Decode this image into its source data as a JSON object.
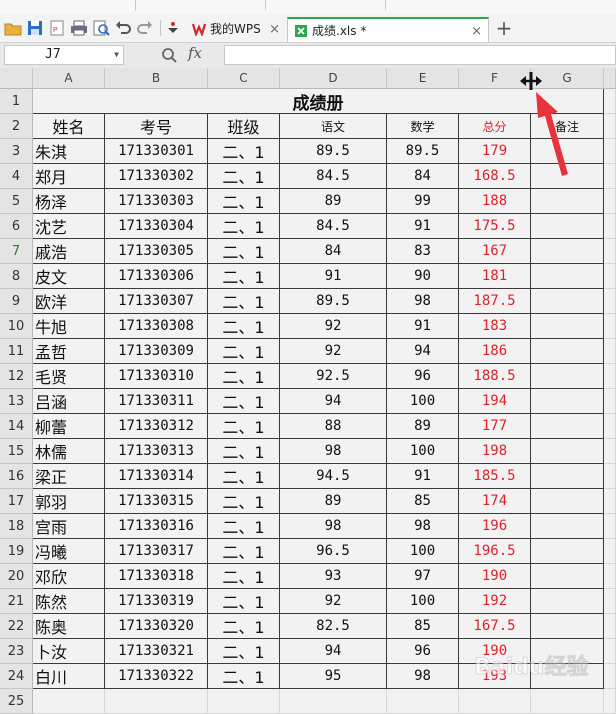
{
  "tabs": {
    "wps_label": "我的WPS",
    "file_label": "成绩.xls *",
    "close_glyph": "×",
    "add_glyph": "+"
  },
  "formula_bar": {
    "name_box": "J7",
    "fx_label": "fx",
    "formula": ""
  },
  "sheet": {
    "columns": [
      "A",
      "B",
      "C",
      "D",
      "E",
      "F",
      "G"
    ],
    "selected_row": 7,
    "title": "成绩册",
    "headers": [
      "姓名",
      "考号",
      "班级",
      "语文",
      "数学",
      "总分",
      "备注"
    ],
    "rows": [
      {
        "n": "3",
        "name": "朱淇",
        "id": "171330301",
        "cls": "二、1",
        "yw": "89.5",
        "sx": "89.5",
        "zf": "179"
      },
      {
        "n": "4",
        "name": "郑月",
        "id": "171330302",
        "cls": "二、1",
        "yw": "84.5",
        "sx": "84",
        "zf": "168.5"
      },
      {
        "n": "5",
        "name": "杨泽",
        "id": "171330303",
        "cls": "二、1",
        "yw": "89",
        "sx": "99",
        "zf": "188"
      },
      {
        "n": "6",
        "name": "沈艺",
        "id": "171330304",
        "cls": "二、1",
        "yw": "84.5",
        "sx": "91",
        "zf": "175.5"
      },
      {
        "n": "7",
        "name": "戚浩",
        "id": "171330305",
        "cls": "二、1",
        "yw": "84",
        "sx": "83",
        "zf": "167"
      },
      {
        "n": "8",
        "name": "皮文",
        "id": "171330306",
        "cls": "二、1",
        "yw": "91",
        "sx": "90",
        "zf": "181"
      },
      {
        "n": "9",
        "name": "欧洋",
        "id": "171330307",
        "cls": "二、1",
        "yw": "89.5",
        "sx": "98",
        "zf": "187.5"
      },
      {
        "n": "10",
        "name": "牛旭",
        "id": "171330308",
        "cls": "二、1",
        "yw": "92",
        "sx": "91",
        "zf": "183"
      },
      {
        "n": "11",
        "name": "孟哲",
        "id": "171330309",
        "cls": "二、1",
        "yw": "92",
        "sx": "94",
        "zf": "186"
      },
      {
        "n": "12",
        "name": "毛贤",
        "id": "171330310",
        "cls": "二、1",
        "yw": "92.5",
        "sx": "96",
        "zf": "188.5"
      },
      {
        "n": "13",
        "name": "吕涵",
        "id": "171330311",
        "cls": "二、1",
        "yw": "94",
        "sx": "100",
        "zf": "194"
      },
      {
        "n": "14",
        "name": "柳蕾",
        "id": "171330312",
        "cls": "二、1",
        "yw": "88",
        "sx": "89",
        "zf": "177"
      },
      {
        "n": "15",
        "name": "林儒",
        "id": "171330313",
        "cls": "二、1",
        "yw": "98",
        "sx": "100",
        "zf": "198"
      },
      {
        "n": "16",
        "name": "梁正",
        "id": "171330314",
        "cls": "二、1",
        "yw": "94.5",
        "sx": "91",
        "zf": "185.5"
      },
      {
        "n": "17",
        "name": "郭羽",
        "id": "171330315",
        "cls": "二、1",
        "yw": "89",
        "sx": "85",
        "zf": "174"
      },
      {
        "n": "18",
        "name": "宫雨",
        "id": "171330316",
        "cls": "二、1",
        "yw": "98",
        "sx": "98",
        "zf": "196"
      },
      {
        "n": "19",
        "name": "冯曦",
        "id": "171330317",
        "cls": "二、1",
        "yw": "96.5",
        "sx": "100",
        "zf": "196.5"
      },
      {
        "n": "20",
        "name": "邓欣",
        "id": "171330318",
        "cls": "二、1",
        "yw": "93",
        "sx": "97",
        "zf": "190"
      },
      {
        "n": "21",
        "name": "陈然",
        "id": "171330319",
        "cls": "二、1",
        "yw": "92",
        "sx": "100",
        "zf": "192"
      },
      {
        "n": "22",
        "name": "陈奥",
        "id": "171330320",
        "cls": "二、1",
        "yw": "82.5",
        "sx": "85",
        "zf": "167.5"
      },
      {
        "n": "23",
        "name": "卜汝",
        "id": "171330321",
        "cls": "二、1",
        "yw": "94",
        "sx": "96",
        "zf": "190"
      },
      {
        "n": "24",
        "name": "白川",
        "id": "171330322",
        "cls": "二、1",
        "yw": "95",
        "sx": "98",
        "zf": "193"
      }
    ],
    "title_row_number": "1",
    "header_row_number": "2",
    "extra_row_number": "25"
  },
  "colors": {
    "total_red": "#e0212b",
    "annotation_red": "#e8323c",
    "active_tab_green": "#2aa84a"
  },
  "icons": [
    "open-folder-icon",
    "save-icon",
    "export-pdf-icon",
    "print-icon",
    "print-preview-icon",
    "undo-icon",
    "redo-icon",
    "dropdown-icon",
    "wps-logo-icon",
    "spreadsheet-file-icon",
    "zoom-icon",
    "resize-column-cursor-icon",
    "annotation-arrow-icon"
  ],
  "watermark_text": "Baidu经验"
}
